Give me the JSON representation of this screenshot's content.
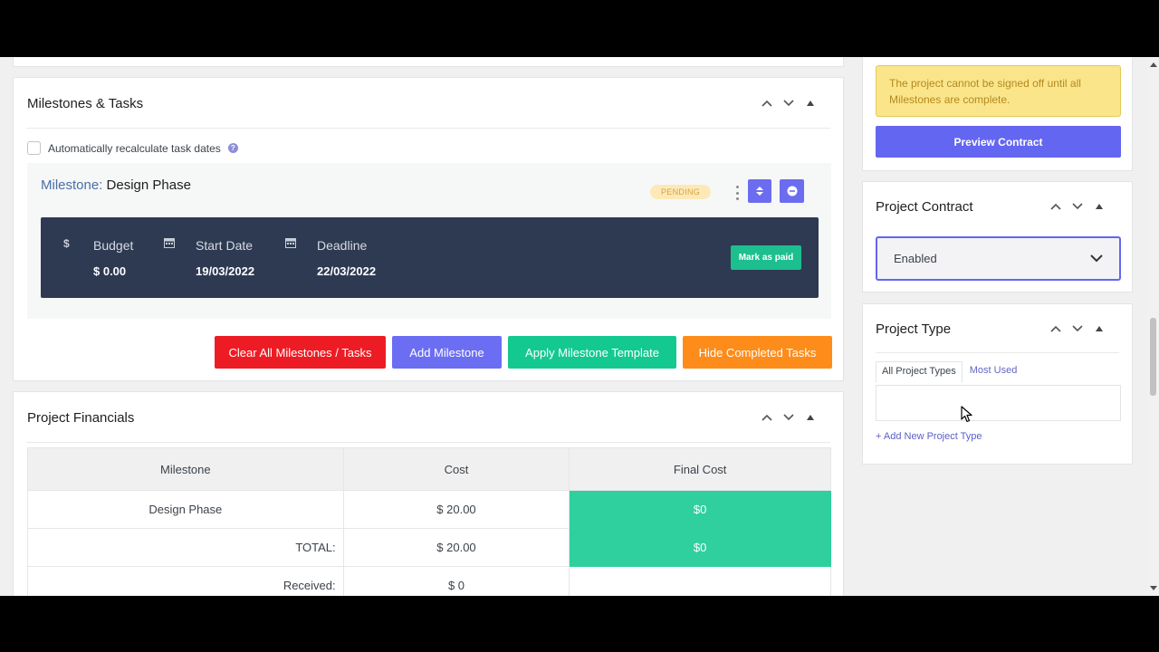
{
  "milestones_panel": {
    "title": "Milestones & Tasks",
    "auto_recalc_label": "Automatically recalculate task dates",
    "milestone": {
      "prefix": "Milestone:",
      "name": "Design Phase",
      "status": "PENDING",
      "budget_label": "Budget",
      "budget_value": "$ 0.00",
      "start_label": "Start Date",
      "start_value": "19/03/2022",
      "deadline_label": "Deadline",
      "deadline_value": "22/03/2022",
      "mark_paid_label": "Mark as paid"
    },
    "buttons": {
      "clear": "Clear All Milestones / Tasks",
      "add": "Add Milestone",
      "apply_template": "Apply Milestone Template",
      "hide_completed": "Hide Completed Tasks"
    }
  },
  "financials_panel": {
    "title": "Project Financials",
    "columns": [
      "Milestone",
      "Cost",
      "Final Cost"
    ],
    "rows": [
      {
        "milestone": "Design Phase",
        "cost": "$ 20.00",
        "final": "$0"
      },
      {
        "milestone": "TOTAL:",
        "cost": "$ 20.00",
        "final": "$0"
      },
      {
        "milestone": "Received:",
        "cost": "$ 0",
        "final": ""
      }
    ]
  },
  "signoff": {
    "warning": "The project cannot be signed off until all Milestones are complete.",
    "preview_label": "Preview Contract"
  },
  "contract_panel": {
    "title": "Project Contract",
    "selected": "Enabled"
  },
  "type_panel": {
    "title": "Project Type",
    "tab_all": "All Project Types",
    "tab_most_used": "Most Used",
    "add_new": "+ Add New Project Type"
  },
  "colors": {
    "accent": "#6366f1",
    "danger": "#ed1c24",
    "success": "#1dbf8e",
    "warning": "#fd8c1a",
    "dark_bar": "#2d3a52"
  }
}
